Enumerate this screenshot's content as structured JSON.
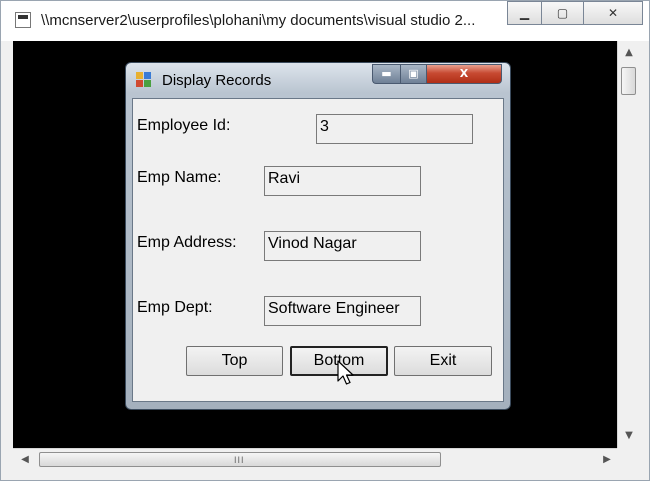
{
  "console": {
    "title": "\\\\mcnserver2\\userprofiles\\plohani\\my documents\\visual studio 2...",
    "minimize_glyph": "▁",
    "maximize_glyph": "▢",
    "close_glyph": "✕",
    "scroll_up_glyph": "▲",
    "scroll_down_glyph": "▼",
    "scroll_left_glyph": "◀",
    "scroll_right_glyph": "▶",
    "grip_glyph": "III"
  },
  "dialog": {
    "title": "Display Records",
    "minimize_glyph": "▬",
    "maximize_glyph": "▣",
    "close_glyph": "X",
    "fields": {
      "employee_id": {
        "label": "Employee Id:",
        "value": "3"
      },
      "emp_name": {
        "label": "Emp Name:",
        "value": "Ravi"
      },
      "emp_address": {
        "label": "Emp Address:",
        "value": "Vinod Nagar"
      },
      "emp_dept": {
        "label": "Emp Dept:",
        "value": "Software Engineer"
      }
    },
    "buttons": {
      "top": "Top",
      "bottom": "Bottom",
      "exit": "Exit"
    }
  },
  "colors": {
    "console_background": "#000000",
    "dialog_close": "#c74a32",
    "client_background": "#f0f0f0"
  },
  "icons": [
    "app-icon",
    "form-icon",
    "mouse-cursor-icon"
  ]
}
